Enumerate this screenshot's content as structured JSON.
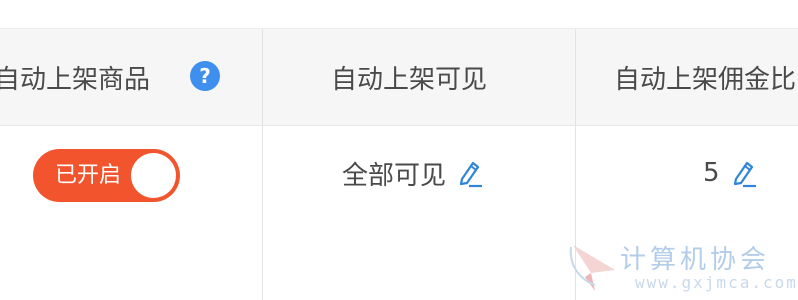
{
  "table": {
    "headers": {
      "auto_list_products": "自动上架商品",
      "auto_list_visible": "自动上架可见",
      "auto_list_commission": "自动上架佣金比"
    },
    "help_icon_glyph": "?",
    "row": {
      "toggle": {
        "label": "已开启",
        "state": "on",
        "color": "#f2542d"
      },
      "visibility_value": "全部可见",
      "commission_value": "5"
    }
  },
  "watermark": {
    "title": "计算机协会",
    "url": "www.gxjmca.com"
  },
  "colors": {
    "header_bg": "#f6f6f6",
    "text": "#4a4a4a",
    "accent_blue": "#3f8fee",
    "toggle_on": "#f2542d"
  },
  "icons": [
    "help-icon",
    "edit-icon",
    "watermark-logo"
  ]
}
